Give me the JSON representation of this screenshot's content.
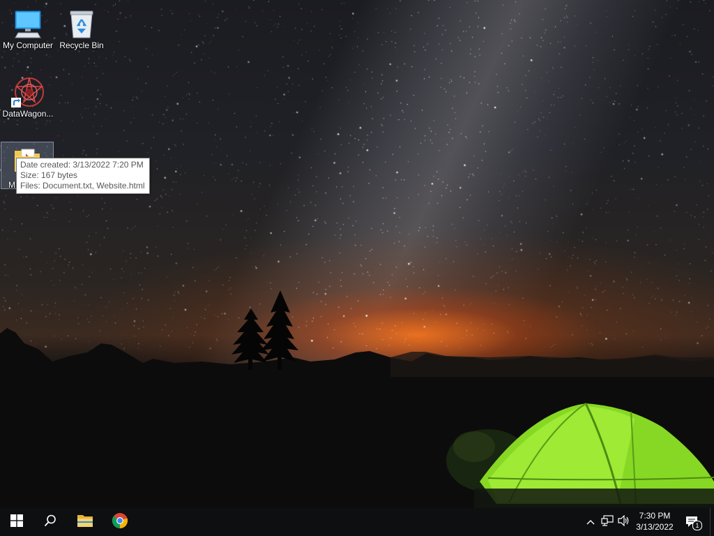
{
  "desktop": {
    "icons": [
      {
        "label": "My Computer",
        "icon": "computer-icon"
      },
      {
        "label": "Recycle Bin",
        "icon": "recycle-bin-icon"
      },
      {
        "label": "DataWagon...",
        "icon": "datawagon-shortcut-icon"
      },
      {
        "label": "M",
        "icon": "folder-icon"
      }
    ]
  },
  "tooltip": {
    "date_created": "Date created: 3/13/2022 7:20 PM",
    "size": "Size: 167 bytes",
    "files": "Files: Document.txt, Website.html"
  },
  "taskbar": {
    "pinned": [
      {
        "name": "Start",
        "icon": "windows-start-icon"
      },
      {
        "name": "Search",
        "icon": "search-icon"
      },
      {
        "name": "File Explorer",
        "icon": "file-explorer-icon"
      },
      {
        "name": "Google Chrome",
        "icon": "chrome-icon"
      }
    ],
    "tray": {
      "time": "7:30 PM",
      "date": "3/13/2022",
      "notification_count": "1"
    }
  },
  "colors": {
    "taskbar": "#0e0f11",
    "tent": "#8fe02a",
    "horizon_glow": "#ff7a1e",
    "accent_blue": "#1e90ff"
  }
}
